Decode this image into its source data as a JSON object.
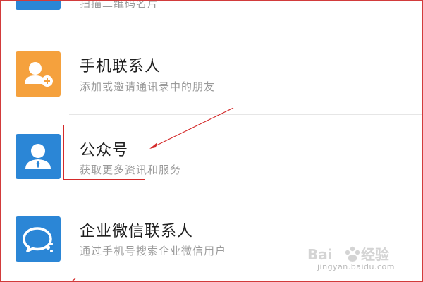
{
  "items": [
    {
      "title": "",
      "subtitle": "扫描二维码名片",
      "icon": "qr-card-icon",
      "color": "#2b86d6"
    },
    {
      "title": "手机联系人",
      "subtitle": "添加或邀请通讯录中的朋友",
      "icon": "add-contact-icon",
      "color": "#f5a13d"
    },
    {
      "title": "公众号",
      "subtitle": "获取更多资讯和服务",
      "icon": "official-account-icon",
      "color": "#2b86d6"
    },
    {
      "title": "企业微信联系人",
      "subtitle": "通过手机号搜索企业微信用户",
      "icon": "wecom-chat-icon",
      "color": "#2b86d6"
    }
  ],
  "watermark": {
    "logo": "Baidu经验",
    "url": "jingyan.baidu.com"
  },
  "annotation_color": "#d42a2a"
}
